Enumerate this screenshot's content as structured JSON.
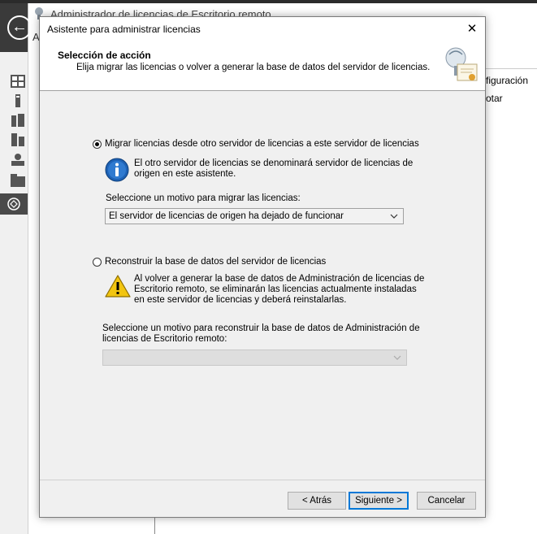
{
  "background_window": {
    "title": "Administrador de licencias de Escritorio remoto",
    "address_partial": "A",
    "right_menu_item_1": "figuración",
    "right_menu_item_2": "otar"
  },
  "dialog": {
    "title": "Asistente para administrar licencias",
    "close_glyph": "✕",
    "header": {
      "title": "Selección de acción",
      "subtitle": "Elija migrar las licencias o volver a generar la base de datos del servidor de licencias."
    },
    "option_migrate": {
      "label": "Migrar licencias desde otro servidor de licencias a este servidor de licencias",
      "checked": true,
      "note_line1": "El otro servidor de licencias se denominará servidor de licencias de",
      "note_line2": "origen en este asistente.",
      "reason_label": "Seleccione un motivo para migrar las licencias:",
      "reason_value": "El servidor de licencias de origen ha dejado de funcionar"
    },
    "option_rebuild": {
      "label": "Reconstruir la base de datos del servidor de licencias",
      "checked": false,
      "warning_line1": "Al volver a generar la base de datos de Administración de licencias de",
      "warning_line2": "Escritorio remoto, se eliminarán las licencias actualmente instaladas",
      "warning_line3": "en este servidor de licencias y deberá reinstalarlas.",
      "reason_label_line1": "Seleccione un motivo para reconstruir la base de datos de Administración de",
      "reason_label_line2": "licencias de Escritorio remoto:",
      "reason_value": ""
    },
    "buttons": {
      "back": "< Atrás",
      "next": "Siguiente >",
      "cancel": "Cancelar"
    }
  }
}
